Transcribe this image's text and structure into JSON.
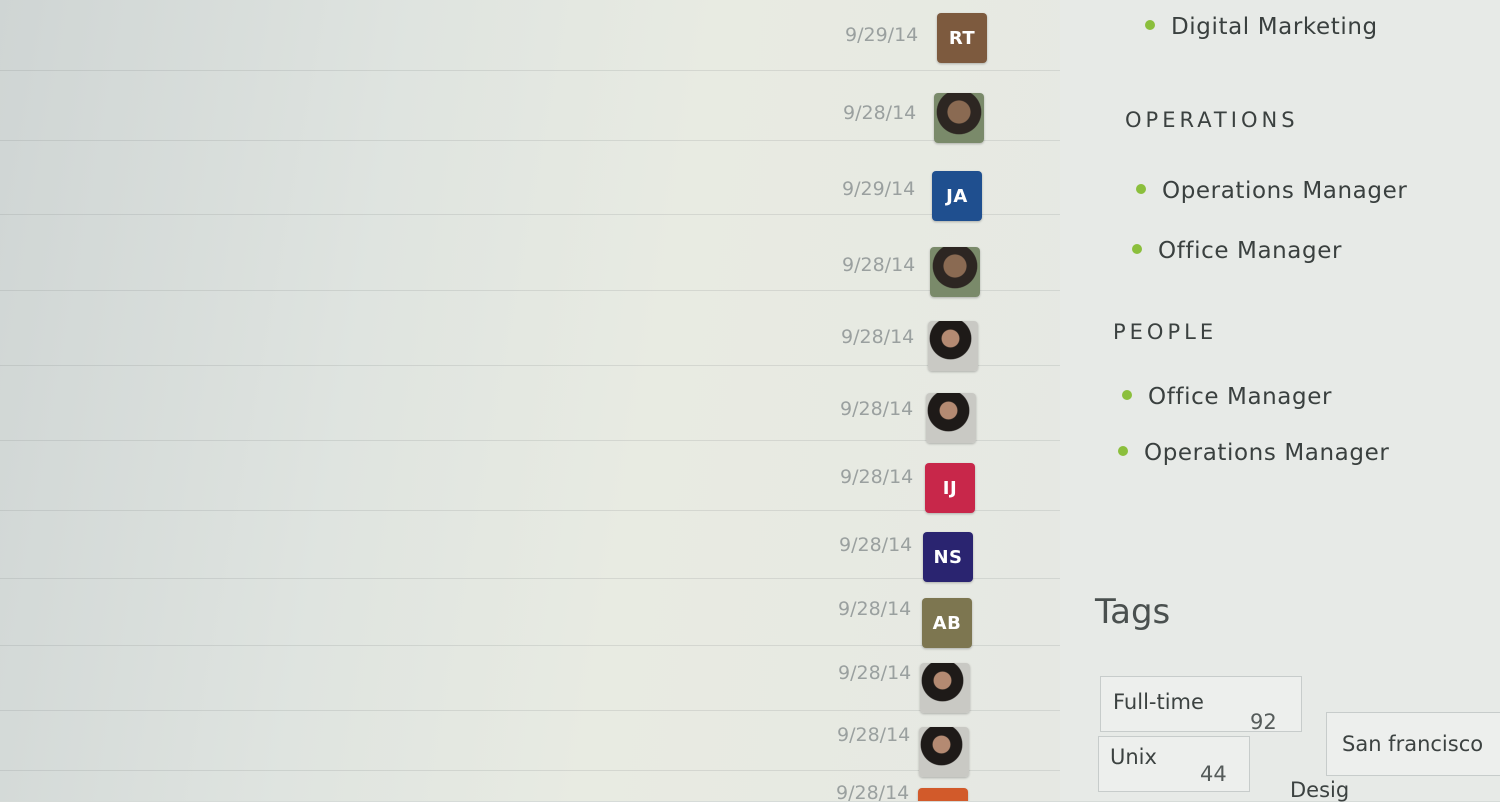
{
  "activity": {
    "dates": [
      "9/29/14",
      "9/28/14",
      "9/29/14",
      "9/28/14",
      "9/28/14",
      "9/28/14",
      "9/28/14",
      "9/28/14",
      "9/28/14",
      "9/28/14",
      "9/28/14",
      "9/28/14"
    ],
    "avatars": [
      {
        "initials": "RT",
        "color": "#7d5a3e"
      },
      {
        "initials": "",
        "color": "photo"
      },
      {
        "initials": "JA",
        "color": "#1f4f8f"
      },
      {
        "initials": "",
        "color": "photo"
      },
      {
        "initials": "",
        "color": "photo2"
      },
      {
        "initials": "",
        "color": "photo2"
      },
      {
        "initials": "IJ",
        "color": "#c8274a"
      },
      {
        "initials": "NS",
        "color": "#2a2470"
      },
      {
        "initials": "AB",
        "color": "#7d7650"
      },
      {
        "initials": "",
        "color": "photo2"
      },
      {
        "initials": "",
        "color": "photo2"
      },
      {
        "initials": "",
        "color": "#d25a2a"
      }
    ]
  },
  "sidebar": {
    "marketing_item": "Digital Marketing",
    "operations_heading": "OPERATIONS",
    "operations_items": [
      "Operations Manager",
      "Office Manager"
    ],
    "people_heading": "PEOPLE",
    "people_items": [
      "Office Manager",
      "Operations Manager"
    ],
    "tags_title": "Tags",
    "tags": [
      {
        "label": "Full-time",
        "count": "92"
      },
      {
        "label": "Unix",
        "count": "44"
      },
      {
        "label": "San francisco",
        "count": ""
      },
      {
        "label": "Desig",
        "count": ""
      }
    ]
  },
  "colors": {
    "bullet": "#8bbf3c"
  }
}
